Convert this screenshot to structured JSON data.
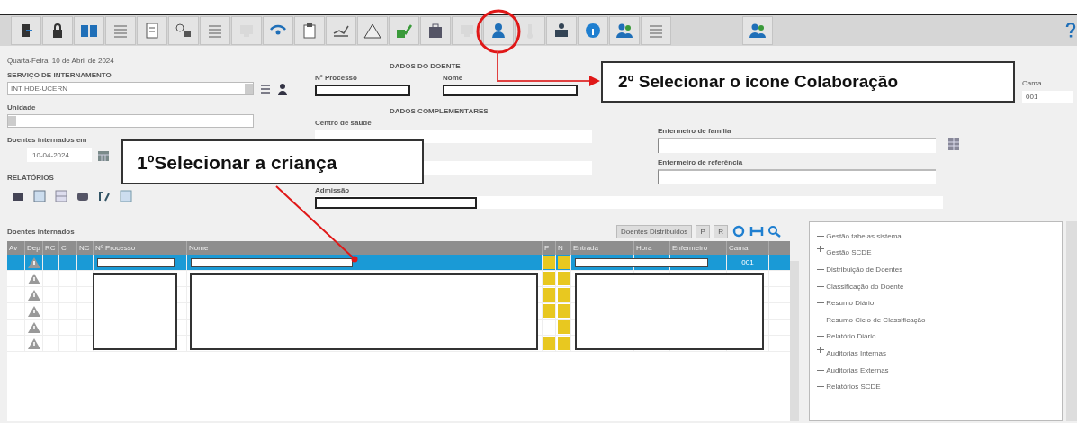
{
  "toolbar": {
    "buttons": [
      {
        "disabled": false
      },
      {
        "disabled": false
      },
      {
        "disabled": false
      },
      {
        "disabled": false
      },
      {
        "disabled": false
      },
      {
        "disabled": false
      },
      {
        "disabled": false
      },
      {
        "disabled": true
      },
      {
        "disabled": false
      },
      {
        "disabled": false
      },
      {
        "disabled": false
      },
      {
        "disabled": false
      },
      {
        "disabled": false
      },
      {
        "disabled": false
      },
      {
        "disabled": true
      },
      {
        "disabled": false
      },
      {
        "disabled": true
      },
      {
        "disabled": false
      },
      {
        "disabled": false
      },
      {
        "disabled": false
      },
      {
        "disabled": false
      },
      {
        "disabled": false
      },
      {
        "disabled": false
      }
    ]
  },
  "date": "Quarta-Feira, 10 de Abril de 2024",
  "service": {
    "label": "SERVIÇO DE INTERNAMENTO",
    "value": "INT HDE-UCERN"
  },
  "unit": {
    "label": "Unidade"
  },
  "admitted_on": {
    "label": "Doentes internados em",
    "value": "10-04-2024"
  },
  "reports": {
    "label": "RELATÓRIOS"
  },
  "patient": {
    "heading": "DADOS DO DOENTE",
    "process_label": "Nº Processo",
    "name_label": "Nome"
  },
  "complementary": {
    "heading": "DADOS COMPLEMENTARES",
    "health_center_label": "Centro de saúde",
    "admission_label": "Admissão"
  },
  "nurses": {
    "family_label": "Enfermeiro de família",
    "reference_label": "Enfermeiro de referência"
  },
  "bed": {
    "label": "Cama",
    "value": "001"
  },
  "inpatients": {
    "title": "Doentes internados",
    "distributed_button": "Doentes Distribuídos",
    "filter_buttons": [
      "P",
      "R"
    ],
    "columns": [
      "Av",
      "Dep",
      "RC",
      "C",
      "NC",
      "Nº Processo",
      "Nome",
      "P",
      "N",
      "Entrada",
      "Hora",
      "Enfermeiro",
      "Cama"
    ],
    "rows": [
      {
        "selected": true,
        "p": true,
        "n": true,
        "bed": "001"
      },
      {
        "selected": false,
        "p": true,
        "n": true
      },
      {
        "selected": false,
        "p": true,
        "n": true
      },
      {
        "selected": false,
        "p": true,
        "n": true
      },
      {
        "selected": false,
        "p": false,
        "n": true
      },
      {
        "selected": false,
        "p": true,
        "n": true
      }
    ]
  },
  "tree": {
    "items": [
      {
        "label": "Gestão tabelas sistema"
      },
      {
        "label": "Gestão SCDE",
        "expanded": false
      },
      {
        "label": "Distribuição de Doentes"
      },
      {
        "label": "Classificação do Doente"
      },
      {
        "label": "Resumo Diário"
      },
      {
        "label": "Resumo Ciclo de Classificação"
      },
      {
        "label": "Relatório Diário"
      },
      {
        "label": "Auditorias Internas",
        "expanded": false
      },
      {
        "label": "Auditorias Externas"
      },
      {
        "label": "Relatórios SCDE"
      }
    ]
  },
  "annotations": [
    {
      "text": "1ºSelecionar a criança"
    },
    {
      "text": "2º Selecionar o icone Colaboração"
    }
  ]
}
